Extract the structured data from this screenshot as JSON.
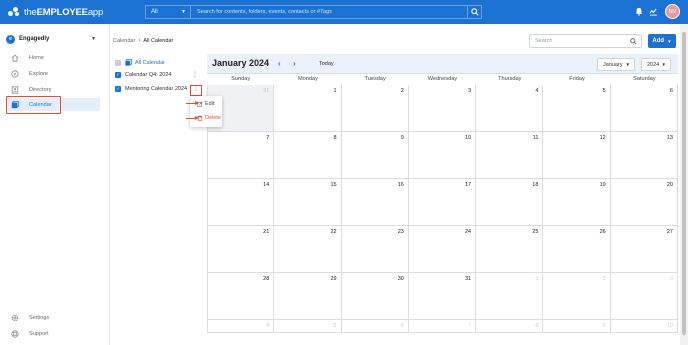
{
  "app": {
    "logo_text_prefix": "the",
    "logo_text_bold": "EMPLOYEE",
    "logo_text_suffix": "app"
  },
  "topbar": {
    "scope_value": "All",
    "search_placeholder": "Search for contents, folders, events, contacts or #Tags",
    "avatar_initials": "NM"
  },
  "sidebar": {
    "org_name": "Engagedly",
    "items": [
      {
        "label": "Home",
        "icon": "home-icon"
      },
      {
        "label": "Explore",
        "icon": "compass-icon"
      },
      {
        "label": "Directory",
        "icon": "directory-icon"
      },
      {
        "label": "Calendar",
        "icon": "calendar-icon",
        "active": true
      }
    ],
    "bottom_items": [
      {
        "label": "Settings",
        "icon": "gear-icon"
      },
      {
        "label": "Support",
        "icon": "support-icon"
      }
    ]
  },
  "breadcrumb": {
    "parent": "Calendar",
    "current": "All Calendar"
  },
  "toolbar": {
    "search_placeholder": "Search",
    "add_label": "Add"
  },
  "calendars": [
    {
      "label": "All Calendar",
      "checked": "partial"
    },
    {
      "label": "Calendar Q4: 2024",
      "checked": true
    },
    {
      "label": "Mentoring Calendar 2024",
      "checked": true
    }
  ],
  "context_menu": {
    "edit_label": "Edit",
    "delete_label": "Delete"
  },
  "calendar": {
    "title": "January 2024",
    "today_label": "Today",
    "month_select": "January",
    "year_select": "2024",
    "weekdays": [
      "Sunday",
      "Monday",
      "Tuesday",
      "Wednesday",
      "Thursday",
      "Friday",
      "Saturday"
    ],
    "weeks": [
      [
        "31",
        "1",
        "2",
        "3",
        "4",
        "5",
        "6"
      ],
      [
        "7",
        "8",
        "9",
        "10",
        "11",
        "12",
        "13"
      ],
      [
        "14",
        "15",
        "16",
        "17",
        "18",
        "19",
        "20"
      ],
      [
        "21",
        "22",
        "23",
        "24",
        "25",
        "26",
        "27"
      ],
      [
        "28",
        "29",
        "30",
        "31",
        "1",
        "2",
        "3"
      ],
      [
        "4",
        "5",
        "6",
        "7",
        "8",
        "9",
        "10"
      ]
    ]
  },
  "colors": {
    "brand": "#1c72d3",
    "highlight": "#e0502e",
    "active_bg": "#e4eefb"
  }
}
